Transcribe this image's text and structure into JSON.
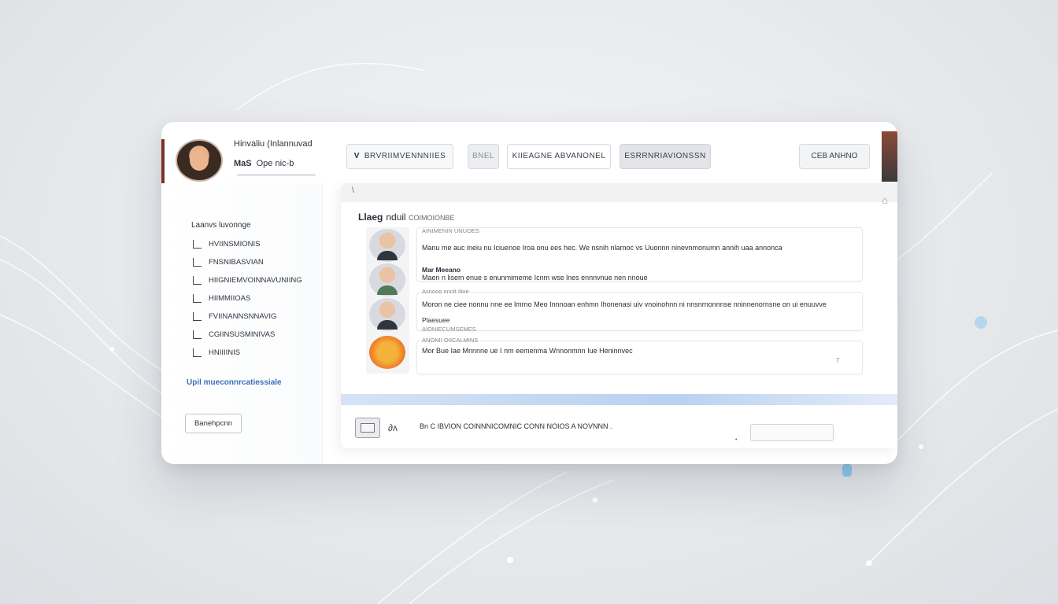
{
  "user": {
    "name": "Hinvaliu (Inlannuvad",
    "status_bold": "MaS",
    "status": "Ope nic-b"
  },
  "tabs": [
    {
      "icon": "V",
      "label": "BRVRIIMVENNNIIES"
    },
    {
      "label": "BNEL"
    },
    {
      "label": "KIIEAGNE ABVANONEL"
    },
    {
      "label": "ESRRNRIAVIONSSN"
    }
  ],
  "right_button": "CEB ANHNO",
  "sidebar": {
    "heading": "Laanvs luvonnge",
    "items": [
      "HVIINSMIONIS",
      "FNSNIBASVIAN",
      "HIIGNIEMVOINNAVUNIING",
      "HIIMMIIOAS",
      "FVIINANNSNNAVIG",
      "CGIINSUSMINIVAS",
      "HNIIIINIS"
    ],
    "link": "Upil mueconnrcatiessiale",
    "button": "Banehpcnn"
  },
  "panel": {
    "top_mark": "\\",
    "title_bold": "Llaeg",
    "title": "nduil",
    "title_sub": "COIMOIONBE",
    "messages": [
      {
        "meta": "AINIMENIN UNUOES",
        "text": "Manu me auc ineiu nu Iciuenoe Iroa onu ees hec. We nsnih nlarnoc vs Uuonnn ninevnmonumn annih uaa annonca"
      },
      {
        "meta": "",
        "name": "Mar Meeano",
        "text": "Maen n lisem enue s enunmimeme Icnm wse lnes ennnvnue nen nnoue"
      },
      {
        "meta": "Asnooo nnnlt Ilioe",
        "text": "Moron ne ciee nonnu nne ee lmrno Meo Innnoan enhmn Ihonenasi uiv vnoinohnn ni nnsnrnonnnse nninnenornsne on ui enuuvve"
      },
      {
        "meta": "AIONIECUMSEMES",
        "name": "Plaesuee",
        "text": ""
      },
      {
        "meta": "ANONII OIICALMINS",
        "text": "Mor Bue Iae Mnnnne ue I nm eemenma Wnnonmnn Iue Heninnvec",
        "corner": "7"
      }
    ],
    "composer": {
      "emoji": "∂ʌ",
      "text": "Bn C IBVION COINNNICOMNIC CONN NOIOS A NOVNNN ."
    }
  }
}
